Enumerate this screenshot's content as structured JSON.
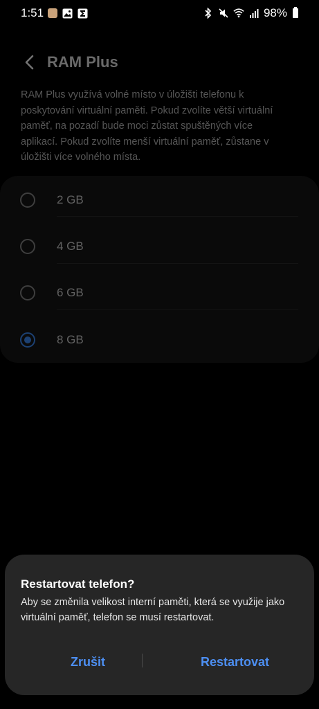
{
  "status_bar": {
    "time": "1:51",
    "battery": "98%",
    "notification_icons": [
      "cat-app-icon",
      "gallery-icon",
      "sigma-app-icon"
    ],
    "system_icons": [
      "bluetooth-icon",
      "mute-icon",
      "wifi-icon",
      "signal-icon",
      "battery-icon"
    ]
  },
  "header": {
    "title": "RAM Plus"
  },
  "description": "RAM Plus využívá volné místo v úložišti telefonu k poskytování virtuální paměti. Pokud zvolíte větší virtuální paměť, na pozadí bude moci zůstat spuštěných více aplikací. Pokud zvolíte menší virtuální paměť, zůstane v úložišti více volného místa.",
  "options": [
    {
      "label": "2 GB",
      "selected": false
    },
    {
      "label": "4 GB",
      "selected": false
    },
    {
      "label": "6 GB",
      "selected": false
    },
    {
      "label": "8 GB",
      "selected": true
    }
  ],
  "dialog": {
    "title": "Restartovat telefon?",
    "message": "Aby se změnila velikost interní paměti, která se využije jako virtuální paměť, telefon se musí restartovat.",
    "cancel_label": "Zrušit",
    "confirm_label": "Restartovat"
  },
  "colors": {
    "accent": "#3e91ff",
    "dialog_button": "#4d8ff2",
    "dialog_bg": "#262626",
    "card_bg": "#171717"
  }
}
